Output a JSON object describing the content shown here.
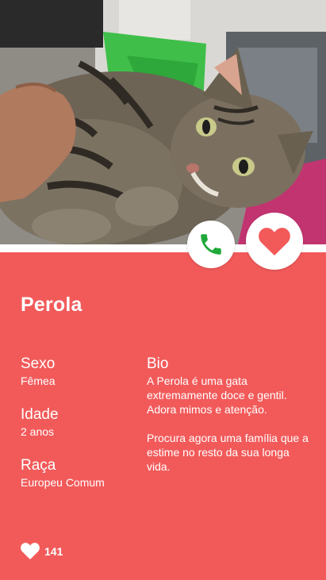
{
  "pet": {
    "name": "Perola",
    "photo_alt": "Gato tigrado deitado"
  },
  "details": {
    "sexo_label": "Sexo",
    "sexo_value": "Fêmea",
    "idade_label": "Idade",
    "idade_value": "2 anos",
    "raca_label": "Raça",
    "raca_value": "Europeu Comum"
  },
  "bio": {
    "label": "Bio",
    "paragraph1": "A Perola é uma gata extremamente doce e gentil. Adora mimos e atenção.",
    "paragraph2": "Procura agora uma família que a estime no resto da sua longa vida."
  },
  "likes": {
    "count": "141"
  },
  "icons": {
    "call": "phone-icon",
    "favorite": "heart-icon",
    "likes": "heart-icon"
  },
  "colors": {
    "accent": "#f25a5a",
    "call_green": "#1fa93a",
    "white": "#ffffff"
  }
}
